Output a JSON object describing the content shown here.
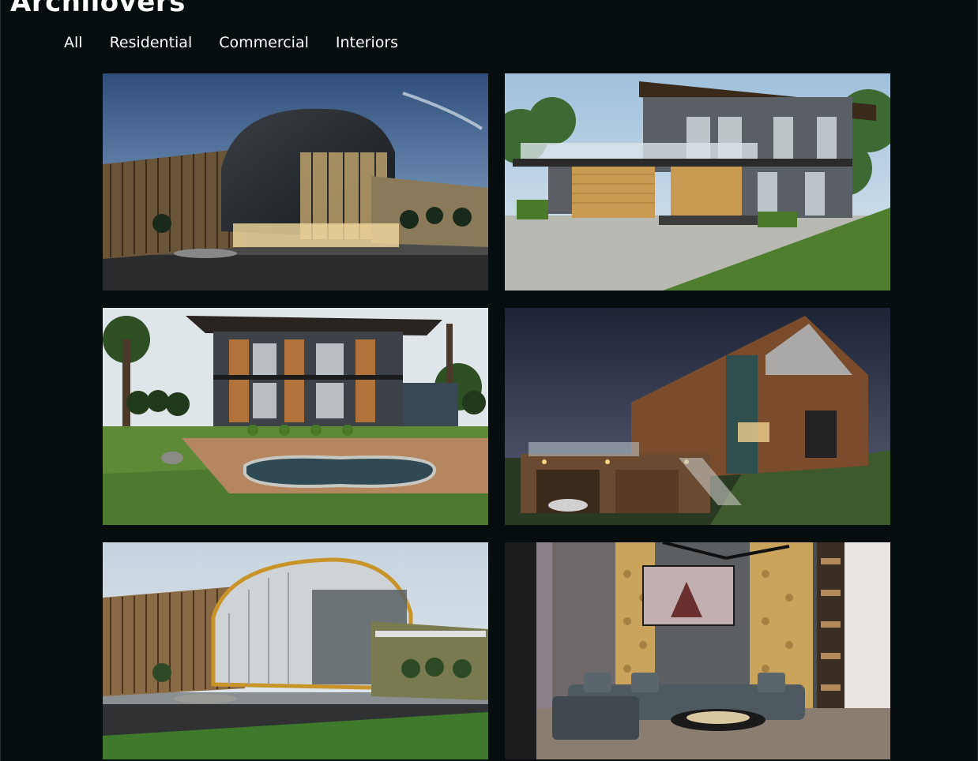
{
  "header": {
    "brand": "Archilovers"
  },
  "filters": [
    {
      "label": "All"
    },
    {
      "label": "Residential"
    },
    {
      "label": "Commercial"
    },
    {
      "label": "Interiors"
    }
  ],
  "gallery": {
    "tiles": [
      {
        "subject": "commercial-building-dusk"
      },
      {
        "subject": "modern-house-day"
      },
      {
        "subject": "house-with-pool"
      },
      {
        "subject": "house-night-garage"
      },
      {
        "subject": "commercial-building-day"
      },
      {
        "subject": "living-room-interior"
      }
    ]
  }
}
